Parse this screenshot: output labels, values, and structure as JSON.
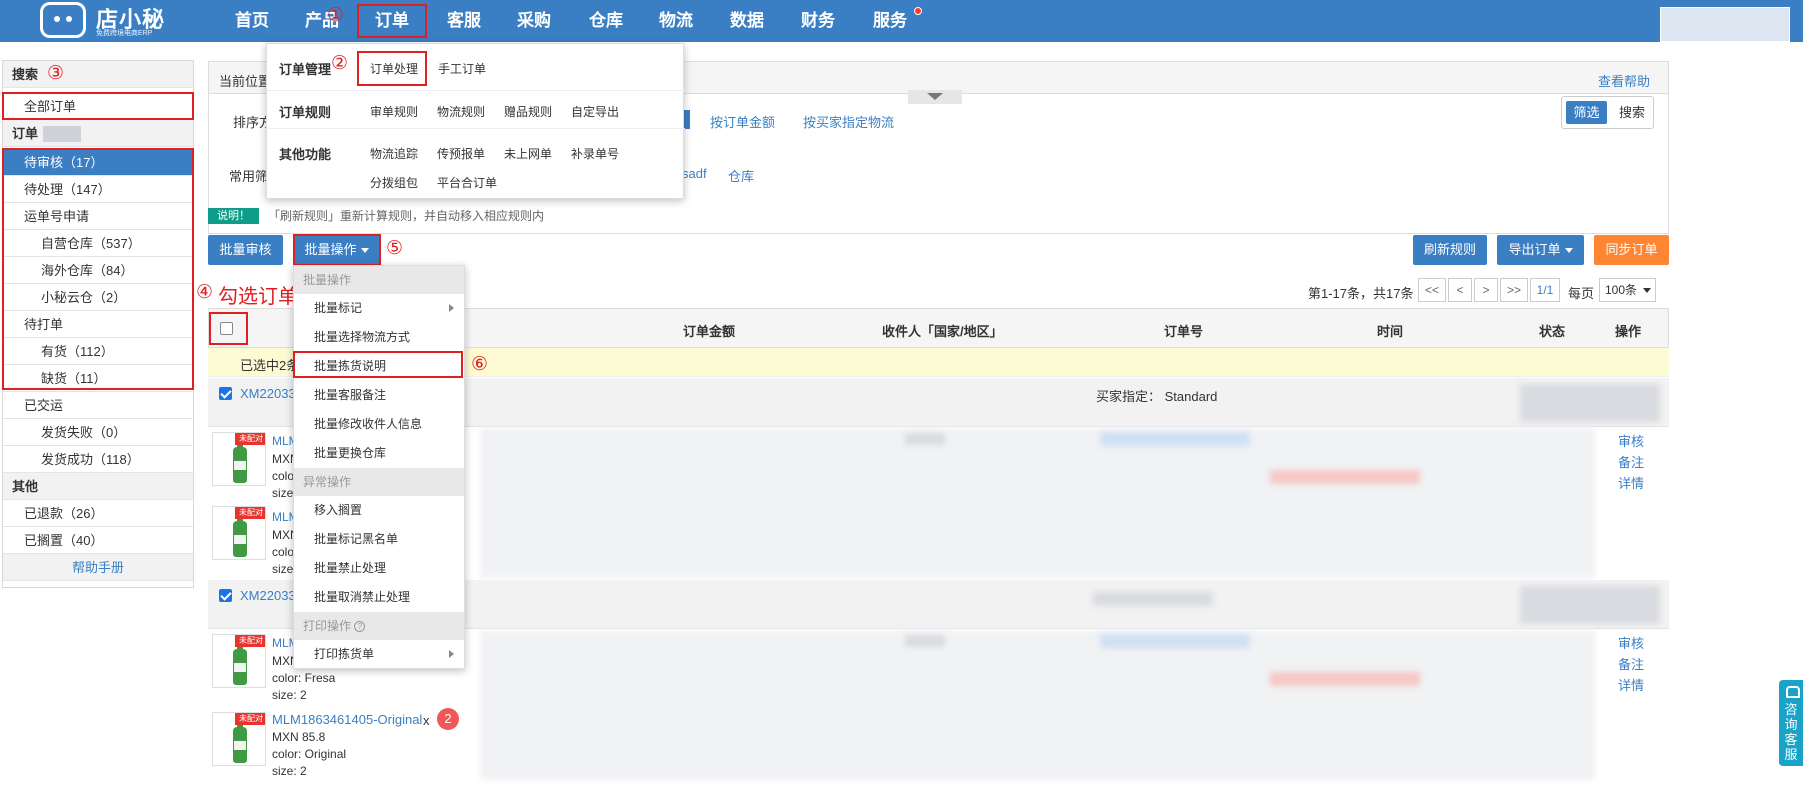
{
  "logo": {
    "name": "店小秘",
    "tagline": "免费跨境电商ERP"
  },
  "nav": [
    "首页",
    "产品",
    "订单",
    "客服",
    "采购",
    "仓库",
    "物流",
    "数据",
    "财务",
    "服务"
  ],
  "markers": [
    "①",
    "②",
    "③",
    "④",
    "⑤",
    "⑥"
  ],
  "annotation_check": "勾选订单",
  "sidebar": {
    "search_head": "搜索",
    "all_orders": "全部订单",
    "orders_head": "订单",
    "pending_review": "待审核（17）",
    "pending_process": "待处理（147）",
    "waybill_apply": "运单号申请",
    "own_warehouse": "自营仓库（537）",
    "overseas_warehouse": "海外仓库（84）",
    "xiaomi_cloud": "小秘云仓（2）",
    "to_print": "待打单",
    "in_stock": "有货（112）",
    "out_of_stock": "缺货（11）",
    "delivered": "已交运",
    "ship_failed": "发货失败（0）",
    "ship_success": "发货成功（118）",
    "other_head": "其他",
    "refunded": "已退款（26）",
    "on_hold": "已搁置（40）",
    "help_manual": "帮助手册"
  },
  "panel": {
    "location": "当前位置",
    "help": "查看帮助",
    "sort_label": "排序方",
    "sort_amount": "按订单金额",
    "sort_buyer_logistics": "按买家指定物流",
    "common_label": "常用筛",
    "filter_sadf": "sadf",
    "filter_warehouse": "仓库",
    "filter_btn": "筛选",
    "search_btn": "搜索"
  },
  "order_menu": {
    "manage_head": "订单管理",
    "order_process": "订单处理",
    "manual_order": "手工订单",
    "rules_head": "订单规则",
    "review_rule": "审单规则",
    "logistics_rule": "物流规则",
    "gift_rule": "赠品规则",
    "custom_export": "自定导出",
    "other_head": "其他功能",
    "tracking": "物流追踪",
    "pre_report": "传预报单",
    "not_online": "未上网单",
    "add_tracking": "补录单号",
    "split_pack": "分拨组包",
    "platform_merge": "平台合订单"
  },
  "note": {
    "tag": "说明！",
    "text": "「刷新规则」重新计算规则，并自动移入相应规则内"
  },
  "toolbar": {
    "batch_review": "批量审核",
    "batch_ops": "批量操作",
    "refresh_rules": "刷新规则",
    "export_orders": "导出订单",
    "sync_orders": "同步订单"
  },
  "pager": {
    "info": "第1-17条，共17条",
    "first": "<<",
    "prev": "<",
    "next": ">",
    "last": ">>",
    "current": "1/1",
    "per_page_label": "每页",
    "per_page": "100条"
  },
  "table": {
    "headers": [
      "订单金额",
      "收件人「国家/地区」",
      "订单号",
      "时间",
      "状态",
      "操作"
    ],
    "selected_text": "已选中2条",
    "orders": [
      {
        "no": "XM22033",
        "buyer": "买家指定：  Standard",
        "actions": [
          "审核",
          "备注",
          "详情"
        ],
        "items": [
          {
            "sku": "MLM",
            "price": "MXN",
            "color": "colo",
            "size": "size",
            "badge": "未配对"
          },
          {
            "sku": "MLM",
            "price": "MXN",
            "color": "colo",
            "size": "size",
            "badge": "未配对"
          }
        ]
      },
      {
        "no": "XM22033",
        "actions": [
          "审核",
          "备注",
          "详情"
        ],
        "items": [
          {
            "sku": "MLM",
            "price": "MXN",
            "color": "color:  Fresa",
            "size": "size:  2",
            "badge": "未配对"
          },
          {
            "sku": "MLM1863461405-Original",
            "x": "x",
            "qty": "2",
            "price": "MXN 85.8",
            "color": "color:  Original",
            "size": "size:  2",
            "badge": "未配对"
          }
        ]
      }
    ]
  },
  "bulk_menu": {
    "sec_batch": "批量操作",
    "mark": "批量标记",
    "choose_logistics": "批量选择物流方式",
    "picking_note": "批量拣货说明",
    "cs_note": "批量客服备注",
    "edit_recipient": "批量修改收件人信息",
    "change_warehouse": "批量更换仓库",
    "sec_exception": "异常操作",
    "move_hold": "移入搁置",
    "blacklist": "批量标记黑名单",
    "forbid": "批量禁止处理",
    "unforbid": "批量取消禁止处理",
    "sec_print": "打印操作",
    "print_picking": "打印拣货单"
  },
  "consult": "咨询客服",
  "colors": {
    "brand": "#3a7fc4",
    "annotation": "#e02020",
    "orange": "#ff8533",
    "highlight": "#fdfbd4"
  }
}
